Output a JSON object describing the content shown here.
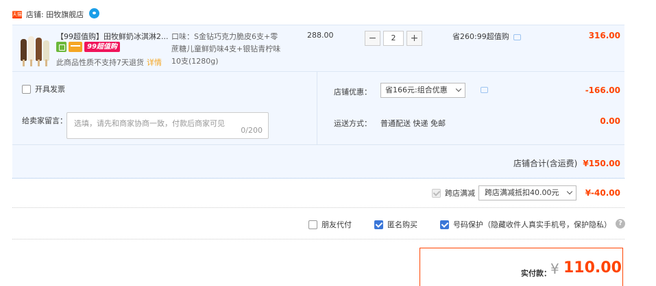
{
  "shop": {
    "badge": "天猫",
    "name": "店铺: 田牧旗舰店"
  },
  "item": {
    "title": "【99超值购】田牧鲜奶冰淇淋2...",
    "badge_99": "99超值购",
    "no_return": "此商品性质不支持7天退货",
    "detail_link": "详情",
    "sku": "口味：S金钻巧克力脆皮6支+零蔗糖儿童鲜奶味4支+银钻青柠味10支(1280g)",
    "price": "288.00",
    "qty": "2",
    "minus": "−",
    "plus": "+",
    "save": "省260:99超值购",
    "subtotal": "316.00"
  },
  "invoice": {
    "label": "开具发票"
  },
  "message": {
    "label": "给卖家留言：",
    "placeholder": "选填，请先和商家协商一致，付款后商家可见",
    "counter": "0/200"
  },
  "coupon": {
    "label": "店铺优惠：",
    "selected": "省166元:组合优惠",
    "value": "-166.00"
  },
  "shipping": {
    "label": "运送方式：",
    "method": "普通配送 快递 免邮",
    "value": "0.00"
  },
  "shop_total": {
    "label": "店铺合计(含运费)",
    "amount": "¥150.00"
  },
  "cross_shop": {
    "label": "跨店满减",
    "selected": "跨店满减抵扣40.00元",
    "value": "¥-40.00"
  },
  "options": {
    "friend_pay": "朋友代付",
    "anonymous": "匿名购买",
    "number_protect": "号码保护（隐藏收件人真实手机号，保护隐私）",
    "help": "?"
  },
  "payment": {
    "label": "实付款：",
    "currency": "¥",
    "amount": "110.00"
  },
  "colors": {
    "accent": "#ff4400",
    "blue": "#3a76d8",
    "row_bg": "#f2f7ff"
  }
}
